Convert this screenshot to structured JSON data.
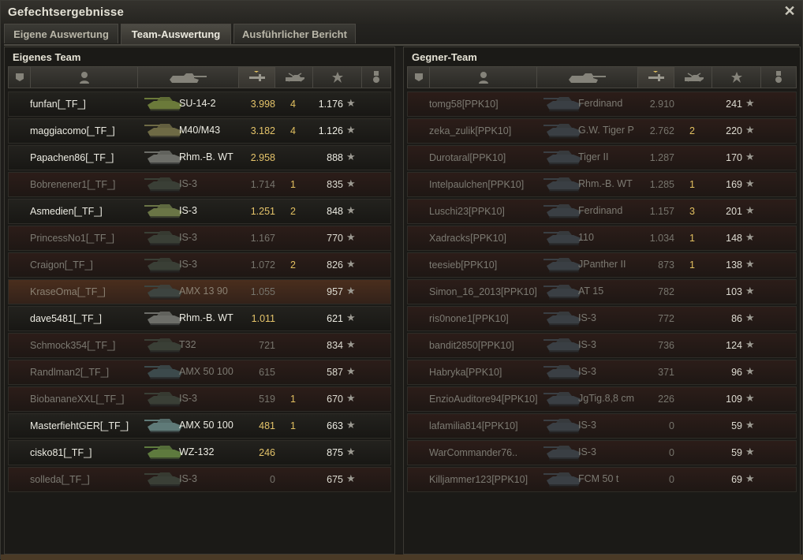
{
  "window": {
    "title": "Gefechtsergebnisse",
    "close_icon": "close-icon"
  },
  "tabs": [
    {
      "label": "Eigene Auswertung",
      "active": false
    },
    {
      "label": "Team-Auswertung",
      "active": true
    },
    {
      "label": "Ausführlicher Bericht",
      "active": false
    }
  ],
  "own_team": {
    "title": "Eigenes Team",
    "columns": [
      "squad-icon",
      "player-icon",
      "tank-icon",
      "damage-icon",
      "kills-icon",
      "xp-star-icon",
      "medal-icon"
    ],
    "rows": [
      {
        "name": "funfan[_TF_]",
        "tank": "SU-14-2",
        "damage": "3.998",
        "kills": "4",
        "xp": "1.176",
        "state": "alive",
        "tank_color": "#6b7a3a"
      },
      {
        "name": "maggiacomo[_TF_]",
        "tank": "M40/M43",
        "damage": "3.182",
        "kills": "4",
        "xp": "1.126",
        "state": "alive",
        "tank_color": "#6e6a45"
      },
      {
        "name": "Papachen86[_TF_]",
        "tank": "Rhm.-B. WT",
        "damage": "2.958",
        "kills": "",
        "xp": "888",
        "state": "alive",
        "tank_color": "#6d6e69"
      },
      {
        "name": "Bobrenener1[_TF_]",
        "tank": "IS-3",
        "damage": "1.714",
        "kills": "1",
        "xp": "835",
        "state": "dead",
        "tank_color": "#3a3f36"
      },
      {
        "name": "Asmedien[_TF_]",
        "tank": "IS-3",
        "damage": "1.251",
        "kills": "2",
        "xp": "848",
        "state": "alive",
        "tank_color": "#6a7546"
      },
      {
        "name": "PrincessNo1[_TF_]",
        "tank": "IS-3",
        "damage": "1.167",
        "kills": "",
        "xp": "770",
        "state": "dead",
        "tank_color": "#3a3f36"
      },
      {
        "name": "Craigon[_TF_]",
        "tank": "IS-3",
        "damage": "1.072",
        "kills": "2",
        "xp": "826",
        "state": "dead",
        "tank_color": "#3a3f36"
      },
      {
        "name": "KraseOma[_TF_]",
        "tank": "AMX 13 90",
        "damage": "1.055",
        "kills": "",
        "xp": "957",
        "state": "player",
        "tank_color": "#3d4440"
      },
      {
        "name": "dave5481[_TF_]",
        "tank": "Rhm.-B. WT",
        "damage": "1.011",
        "kills": "",
        "xp": "621",
        "state": "alive",
        "tank_color": "#6d6e69"
      },
      {
        "name": "Schmock354[_TF_]",
        "tank": "T32",
        "damage": "721",
        "kills": "",
        "xp": "834",
        "state": "dead",
        "tank_color": "#3a3f36"
      },
      {
        "name": "Randlman2[_TF_]",
        "tank": "AMX 50 100",
        "damage": "615",
        "kills": "",
        "xp": "587",
        "state": "dead",
        "tank_color": "#3c4a4c"
      },
      {
        "name": "BiobananeXXL[_TF_]",
        "tank": "IS-3",
        "damage": "519",
        "kills": "1",
        "xp": "670",
        "state": "dead",
        "tank_color": "#3a3f36"
      },
      {
        "name": "MasterfiehtGER[_TF_]",
        "tank": "AMX 50 100",
        "damage": "481",
        "kills": "1",
        "xp": "663",
        "state": "alive",
        "tank_color": "#5f7a78"
      },
      {
        "name": "cisko81[_TF_]",
        "tank": "WZ-132",
        "damage": "246",
        "kills": "",
        "xp": "875",
        "state": "alive",
        "tank_color": "#5e7a3e"
      },
      {
        "name": "solleda[_TF_]",
        "tank": "IS-3",
        "damage": "0",
        "kills": "",
        "xp": "675",
        "state": "dead",
        "tank_color": "#3a3f36"
      }
    ]
  },
  "enemy_team": {
    "title": "Gegner-Team",
    "columns": [
      "squad-icon",
      "player-icon",
      "tank-icon",
      "damage-icon",
      "kills-icon",
      "xp-star-icon",
      "medal-icon"
    ],
    "rows": [
      {
        "name": "tomg58[PPK10]",
        "tank": "Ferdinand",
        "damage": "2.910",
        "kills": "",
        "xp": "241",
        "state": "dead",
        "tank_color": "#3a3f44"
      },
      {
        "name": "zeka_zulik[PPK10]",
        "tank": "G.W. Tiger P",
        "damage": "2.762",
        "kills": "2",
        "xp": "220",
        "state": "dead",
        "tank_color": "#3a3f44"
      },
      {
        "name": "Durotaral[PPK10]",
        "tank": "Tiger II",
        "damage": "1.287",
        "kills": "",
        "xp": "170",
        "state": "dead",
        "tank_color": "#3a3f44"
      },
      {
        "name": "Intelpaulchen[PPK10]",
        "tank": "Rhm.-B. WT",
        "damage": "1.285",
        "kills": "1",
        "xp": "169",
        "state": "dead",
        "tank_color": "#3a3f44"
      },
      {
        "name": "Luschi23[PPK10]",
        "tank": "Ferdinand",
        "damage": "1.157",
        "kills": "3",
        "xp": "201",
        "state": "dead",
        "tank_color": "#3a3f44"
      },
      {
        "name": "Xadracks[PPK10]",
        "tank": "110",
        "damage": "1.034",
        "kills": "1",
        "xp": "148",
        "state": "dead",
        "tank_color": "#3a3f44"
      },
      {
        "name": "teesieb[PPK10]",
        "tank": "JPanther II",
        "damage": "873",
        "kills": "1",
        "xp": "138",
        "state": "dead",
        "tank_color": "#3a3f44"
      },
      {
        "name": "Simon_16_2013[PPK10]",
        "tank": "AT 15",
        "damage": "782",
        "kills": "",
        "xp": "103",
        "state": "dead",
        "tank_color": "#3a3f44"
      },
      {
        "name": "ris0none1[PPK10]",
        "tank": "IS-3",
        "damage": "772",
        "kills": "",
        "xp": "86",
        "state": "dead",
        "tank_color": "#3a3f44"
      },
      {
        "name": "bandit2850[PPK10]",
        "tank": "IS-3",
        "damage": "736",
        "kills": "",
        "xp": "124",
        "state": "dead",
        "tank_color": "#3a3f44"
      },
      {
        "name": "Habryka[PPK10]",
        "tank": "IS-3",
        "damage": "371",
        "kills": "",
        "xp": "96",
        "state": "dead",
        "tank_color": "#3a3f44"
      },
      {
        "name": "EnzioAuditore94[PPK10]",
        "tank": "JgTig.8,8 cm",
        "damage": "226",
        "kills": "",
        "xp": "109",
        "state": "dead",
        "tank_color": "#3a3f44"
      },
      {
        "name": "lafamilia814[PPK10]",
        "tank": "IS-3",
        "damage": "0",
        "kills": "",
        "xp": "59",
        "state": "dead",
        "tank_color": "#3a3f44"
      },
      {
        "name": "WarCommander76..",
        "tank": "IS-3",
        "damage": "0",
        "kills": "",
        "xp": "59",
        "state": "dead",
        "tank_color": "#3a3f44"
      },
      {
        "name": "Killjammer123[PPK10]",
        "tank": "FCM 50 t",
        "damage": "0",
        "kills": "",
        "xp": "69",
        "state": "dead",
        "tank_color": "#3a3f44"
      }
    ]
  }
}
